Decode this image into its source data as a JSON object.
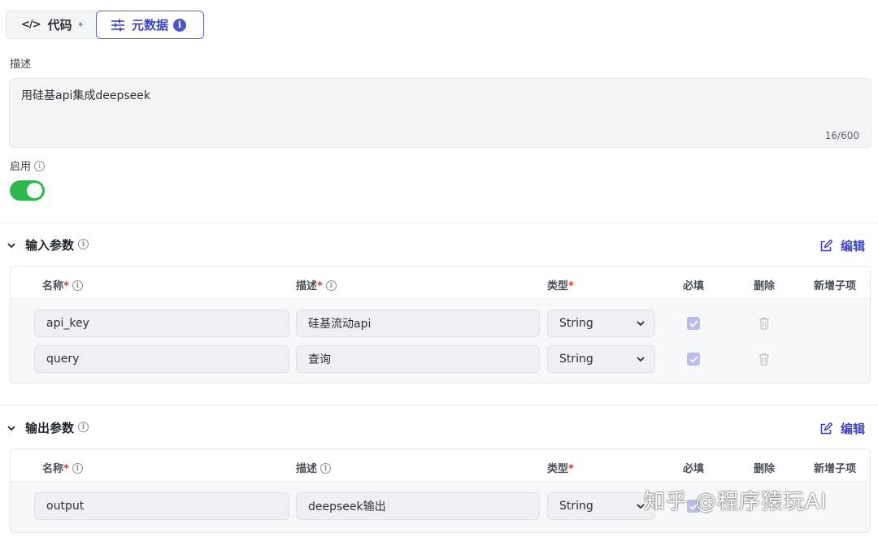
{
  "tabs": [
    {
      "icon": "code-icon",
      "label": "代码",
      "icon_glyph": "</>",
      "spark": "✦"
    },
    {
      "icon": "sliders-icon",
      "label": "元数据",
      "badge": "i",
      "active": true
    }
  ],
  "description": {
    "label": "描述",
    "value": "用硅基api集成deepseek",
    "counter": "16/600"
  },
  "enable": {
    "label": "启用",
    "on": true,
    "accent": "#2fb84f"
  },
  "input_params": {
    "title": "输入参数",
    "edit_label": "编辑",
    "headers": {
      "name": "名称",
      "desc": "描述",
      "type": "类型",
      "required": "必填",
      "delete": "删除",
      "add_child": "新增子项"
    },
    "rows": [
      {
        "name": "api_key",
        "desc": "硅基流动api",
        "type": "String",
        "required": true
      },
      {
        "name": "query",
        "desc": "查询",
        "type": "String",
        "required": true
      }
    ]
  },
  "output_params": {
    "title": "输出参数",
    "edit_label": "编辑",
    "headers": {
      "name": "名称",
      "desc": "描述",
      "type": "类型",
      "required": "必填",
      "delete": "删除",
      "add_child": "新增子项"
    },
    "rows": [
      {
        "name": "output",
        "desc": "deepseek输出",
        "type": "String",
        "required": true
      }
    ]
  },
  "watermark": "知乎 @程序猿玩AI",
  "colors": {
    "brand": "#3d46c0",
    "toggle_on": "#2fb84f",
    "required_star": "#d83931"
  }
}
